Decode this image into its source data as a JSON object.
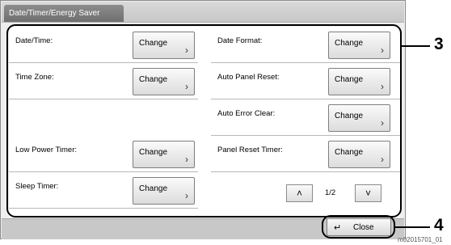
{
  "window": {
    "title": "Date/Timer/Energy Saver"
  },
  "settings": [
    {
      "label": "Date/Time:",
      "button": "Change"
    },
    {
      "label": "Date Format:",
      "button": "Change"
    },
    {
      "label": "Time Zone:",
      "button": "Change"
    },
    {
      "label": "Auto Panel Reset:",
      "button": "Change"
    },
    {
      "label": "Auto Error Clear:",
      "button": "Change"
    },
    {
      "label": "Low Power Timer:",
      "button": "Change"
    },
    {
      "label": "Panel Reset Timer:",
      "button": "Change"
    },
    {
      "label": "Sleep Timer:",
      "button": "Change"
    }
  ],
  "pagination": {
    "page": "1/2",
    "up_icon": "chevron-up-icon",
    "down_icon": "chevron-down-icon"
  },
  "footer": {
    "close_label": "Close",
    "close_icon": "return-arrow-icon"
  },
  "callouts": {
    "settings_marker": "3",
    "close_marker": "4"
  },
  "reference_code": "m02015701_01"
}
